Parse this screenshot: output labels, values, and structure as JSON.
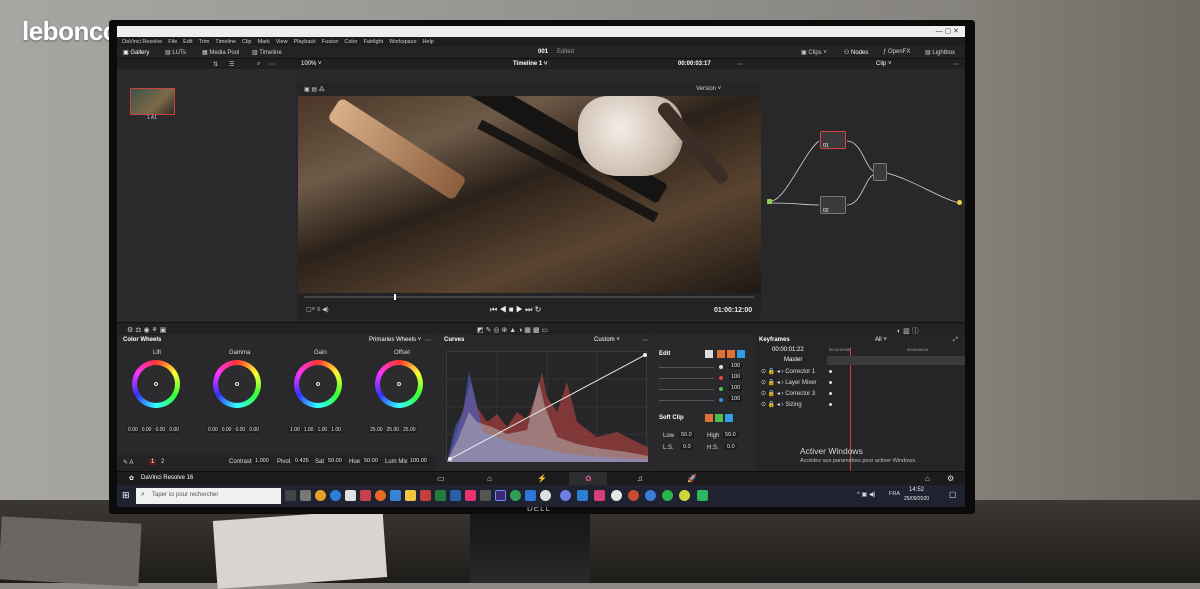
{
  "photo": {
    "site_logo": "leboncoin",
    "monitor_brand": "DELL"
  },
  "app": {
    "title": "DaVinci Resolve",
    "menu": [
      "DaVinci Resolve",
      "File",
      "Edit",
      "Trim",
      "Timeline",
      "Clip",
      "Mark",
      "View",
      "Playback",
      "Fusion",
      "Color",
      "Fairlight",
      "Workspace",
      "Help"
    ],
    "toolbar": {
      "gallery": "Gallery",
      "luts": "LUTs",
      "media_pool": "Media Pool",
      "timeline": "Timeline",
      "project_name": "001",
      "project_status": "Edited",
      "clips": "Clips",
      "nodes": "Nodes",
      "openfx": "OpenFX",
      "lightbox": "Lightbox"
    },
    "viewer_bar": {
      "zoom": "100%",
      "timeline_name": "Timeline 1",
      "timecode": "00:00:03:17",
      "node_mode": "Clip"
    },
    "clip_thumb_label": "1 A1",
    "viewer_option": "Version",
    "transport": {
      "end_timecode": "01:00:12:00"
    },
    "node_graph": {
      "node1_label": "01",
      "node2_label": "02"
    }
  },
  "color_wheels": {
    "title": "Color Wheels",
    "mode": "Primaries Wheels",
    "wheels": [
      {
        "name": "Lift",
        "values": [
          "0.00",
          "0.00",
          "0.00",
          "0.00"
        ]
      },
      {
        "name": "Gamma",
        "values": [
          "0.00",
          "0.00",
          "0.00",
          "0.00"
        ]
      },
      {
        "name": "Gain",
        "values": [
          "1.00",
          "1.00",
          "1.00",
          "1.00"
        ]
      },
      {
        "name": "Offset",
        "values": [
          "25.00",
          "25.00",
          "25.00"
        ]
      }
    ],
    "page_buttons": [
      "1",
      "2"
    ],
    "params": [
      {
        "label": "Contrast",
        "value": "1.000"
      },
      {
        "label": "Pivot",
        "value": "0.435"
      },
      {
        "label": "Sat",
        "value": "50.00"
      },
      {
        "label": "Hue",
        "value": "50.00"
      },
      {
        "label": "Lum Mix",
        "value": "100.00"
      }
    ]
  },
  "curves": {
    "title": "Curves",
    "mode": "Custom"
  },
  "edit_panel": {
    "title": "Edit",
    "channels": [
      "Y",
      "R",
      "G",
      "B"
    ],
    "values": [
      "100",
      "100",
      "100",
      "100"
    ],
    "soft_clip": "Soft Clip",
    "low_label": "Low",
    "low_value": "50.0",
    "high_label": "High",
    "high_value": "50.0",
    "ls_label": "L.S.",
    "ls_value": "0.0",
    "hs_label": "H.S.",
    "hs_value": "0.0"
  },
  "keyframes": {
    "title": "Keyframes",
    "filter": "All",
    "timecode": "00:00:01:22",
    "ruler_start": "00:00:00:00",
    "ruler_end": "00:00:06:15",
    "tracks": [
      "Master",
      "Corrector 1",
      "Layer Mixer",
      "Corrector 3",
      "Sizing"
    ]
  },
  "footer": {
    "app_name": "DaVinci Resolve 16"
  },
  "windows": {
    "search_placeholder": "Taper ici pour rechercher",
    "activation_title": "Activer Windows",
    "activation_sub": "Accédez aux paramètres pour activer Windows.",
    "lang": "FRA",
    "time": "14:52",
    "date": "25/09/2020"
  },
  "colors": {
    "accent_red": "#d34848",
    "panel": "#2b2b2d",
    "taskbar": "#1f2230"
  }
}
